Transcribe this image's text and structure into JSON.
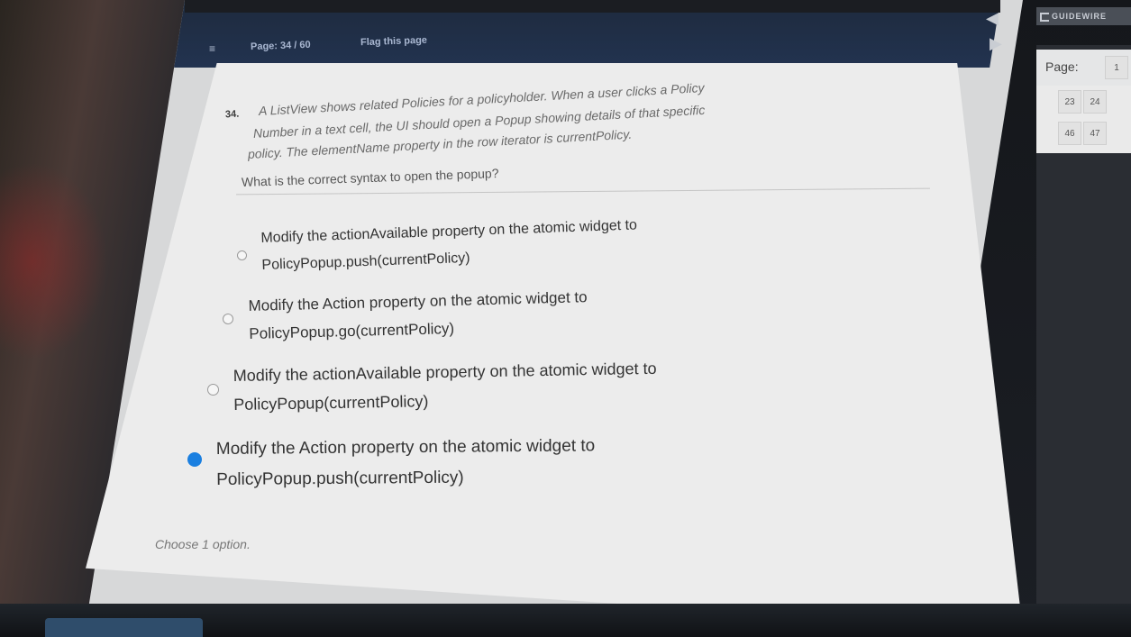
{
  "header": {
    "menu_icon": "hamburger-icon",
    "page_info": "Page: 34 / 60",
    "flag_label": "Flag this page"
  },
  "question": {
    "number": "34.",
    "text_lines": [
      "A ListView shows related Policies for a policyholder. When a user clicks a Policy",
      "Number in a text cell, the UI should open a Popup showing details of that specific",
      "policy. The elementName property in the row iterator is currentPolicy."
    ],
    "prompt": "What is the correct syntax to open the popup?"
  },
  "options": [
    {
      "line1": "Modify the actionAvailable property on the atomic widget to",
      "line2": "PolicyPopup.push(currentPolicy)",
      "selected": false
    },
    {
      "line1": "Modify the Action property on the atomic widget to",
      "line2": "PolicyPopup.go(currentPolicy)",
      "selected": false
    },
    {
      "line1": "Modify the actionAvailable property on the atomic widget to",
      "line2": "PolicyPopup(currentPolicy)",
      "selected": false
    },
    {
      "line1": "Modify the Action property on the atomic widget to",
      "line2": "PolicyPopup.push(currentPolicy)",
      "selected": true
    }
  ],
  "hint": "Choose 1 option.",
  "side_panel": {
    "brand": "GUIDEWIRE",
    "page_label": "Page:",
    "page_cells": [
      "1",
      "23",
      "24",
      "46",
      "47"
    ],
    "prev_icon": "triangle-left-icon",
    "next_icon": "triangle-right-icon"
  },
  "colors": {
    "topbar": "#223350",
    "selected_radio": "#1a7fe0",
    "card": "#ececec"
  }
}
